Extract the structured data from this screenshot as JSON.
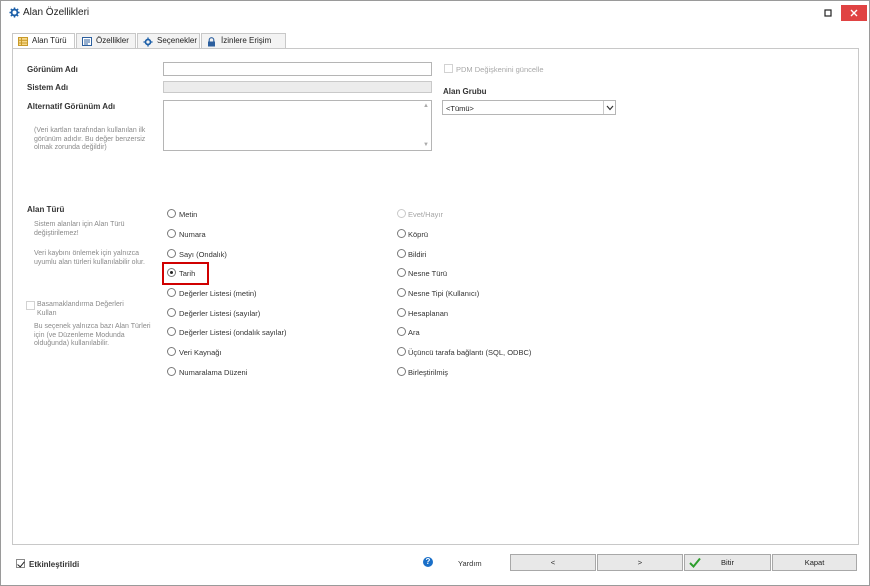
{
  "window": {
    "title": "Alan Özellikleri"
  },
  "tabs": [
    {
      "label": "Alan Türü",
      "icon": "table-icon"
    },
    {
      "label": "Özellikler",
      "icon": "properties-icon"
    },
    {
      "label": "Seçenekler",
      "icon": "gear-icon"
    },
    {
      "label": "İzinlere Erişim",
      "icon": "lock-icon"
    }
  ],
  "form": {
    "display_name_label": "Görünüm Adı",
    "display_name_value": "",
    "system_name_label": "Sistem Adı",
    "system_name_value": "",
    "alt_display_name_label": "Alternatif Görünüm Adı",
    "alt_display_name_value": "",
    "alt_hint": "(Veri kartları tarafından kullanılan ilk görünüm adıdır. Bu değer benzersiz olmak zorunda değildir)",
    "pdm_update_label": "PDM Değişkenini güncelle",
    "group_label": "Alan Grubu",
    "group_value": "<Tümü>"
  },
  "field_type": {
    "label": "Alan Türü",
    "hint1": "Sistem alanları için Alan Türü değiştirilemez!",
    "hint2": "Veri kaybını önlemek için yalnızca uyumlu alan türleri kullanılabilir olur.",
    "cascade_label": "Basamaklandırma Değerleri Kullan",
    "cascade_hint": "Bu seçenek yalnızca bazı Alan Türleri için (ve Düzenleme Modunda olduğunda) kullanılabilir.",
    "selected": "Tarih",
    "left_options": [
      "Metin",
      "Numara",
      "Sayı (Ondalık)",
      "Tarih",
      "Değerler Listesi (metin)",
      "Değerler Listesi (sayılar)",
      "Değerler Listesi (ondalık sayılar)",
      "Veri Kaynağı",
      "Numaralama Düzeni"
    ],
    "right_options": [
      "Evet/Hayır",
      "Köprü",
      "Bildiri",
      "Nesne Türü",
      "Nesne Tipi (Kullanıcı)",
      "Hesaplanan",
      "Ara",
      "Üçüncü tarafa bağlantı (SQL, ODBC)",
      "Birleştirilmiş"
    ]
  },
  "footer": {
    "enabled_label": "Etkinleştirildi",
    "enabled_checked": true,
    "help_label": "Yardım",
    "prev_label": "<",
    "next_label": ">",
    "finish_label": "Bitir",
    "close_label": "Kapat"
  },
  "colors": {
    "close_button": "#e04343",
    "highlight_box": "#d00000",
    "finish_check": "#2e9e2e",
    "help_icon": "#1a6fc8"
  }
}
